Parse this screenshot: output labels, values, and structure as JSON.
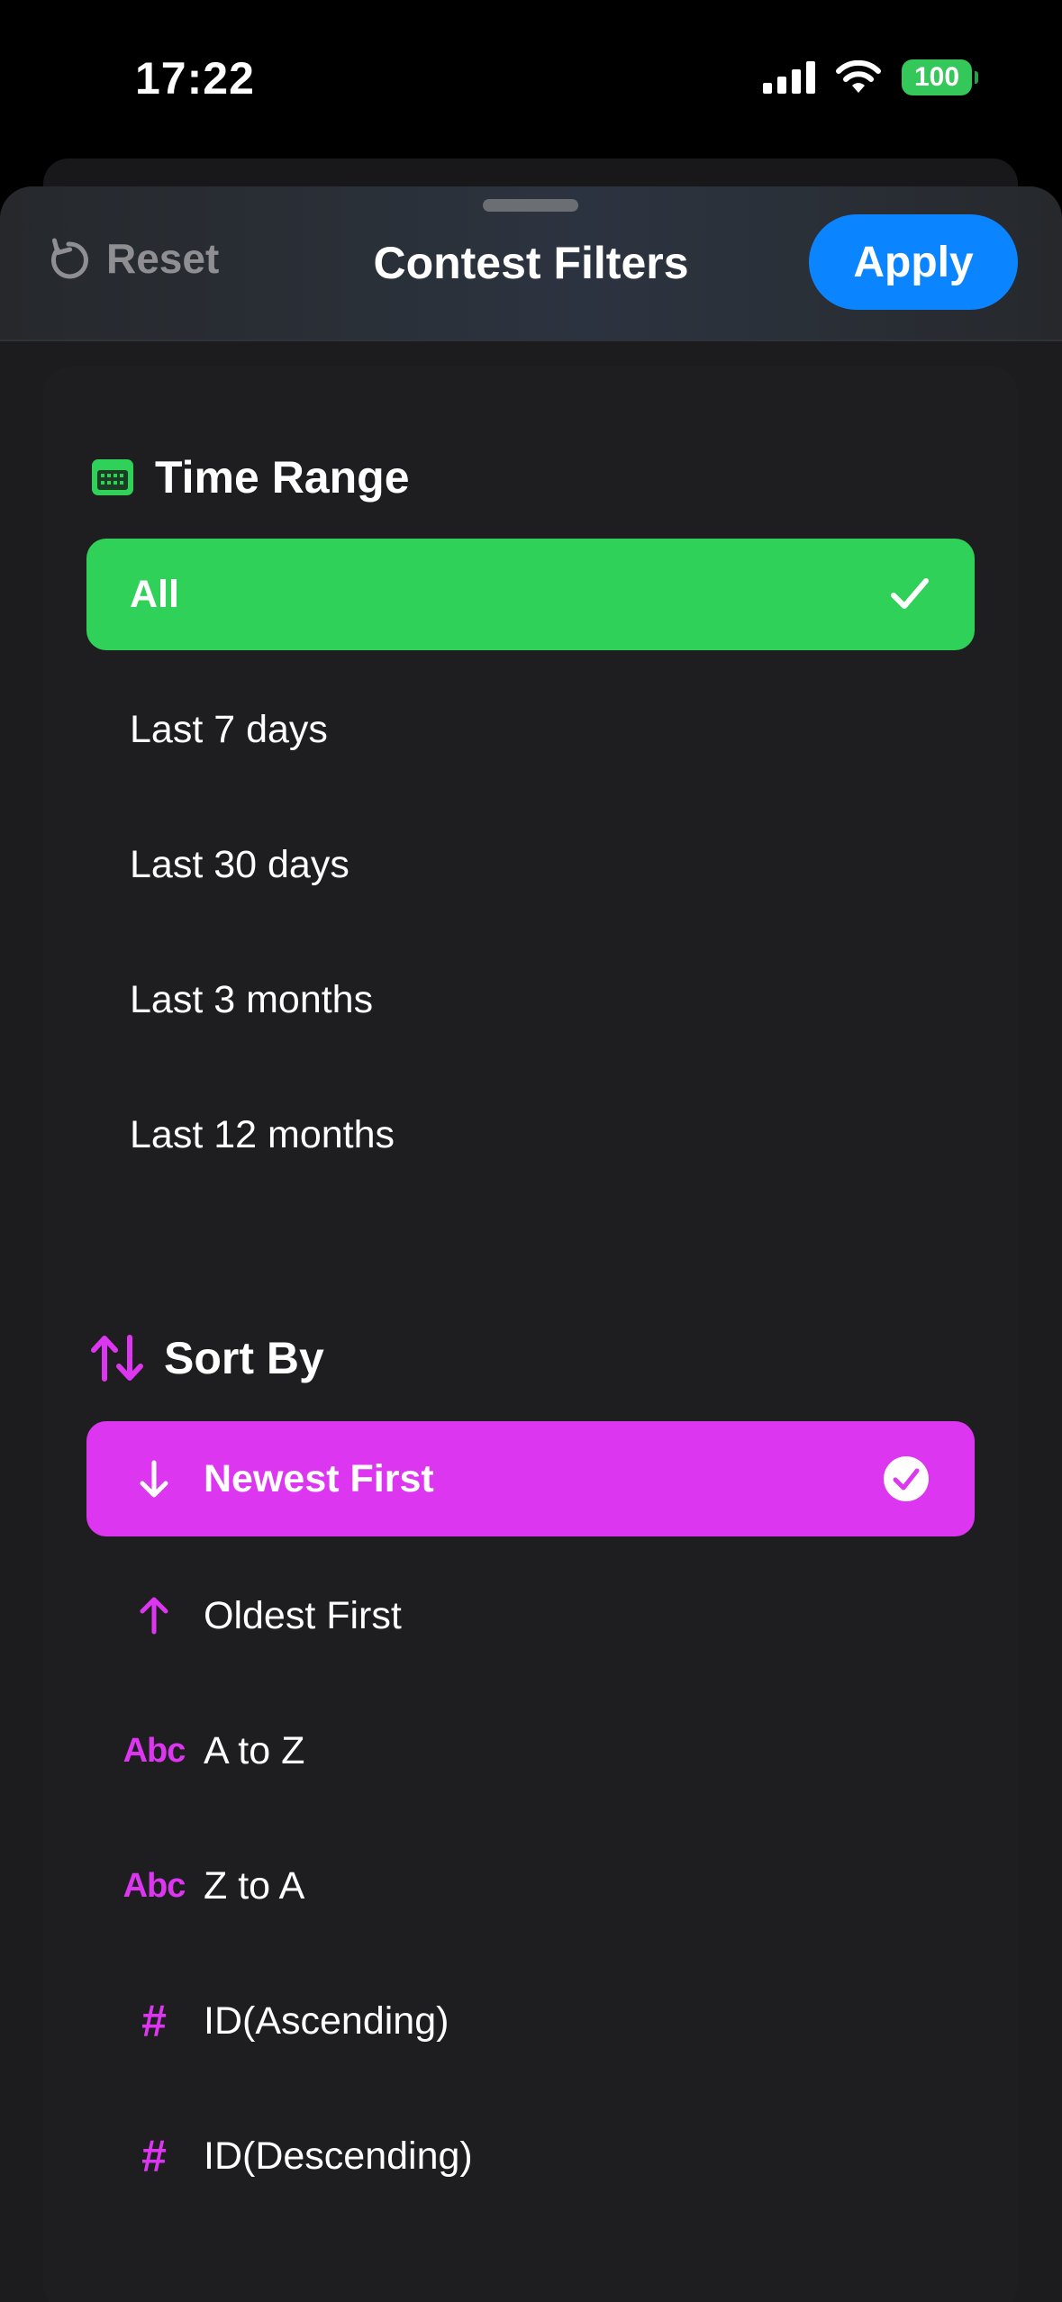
{
  "status_bar": {
    "time": "17:22",
    "battery": "100"
  },
  "nav": {
    "reset_label": "Reset",
    "title": "Contest Filters",
    "apply_label": "Apply"
  },
  "time_range": {
    "title": "Time Range",
    "options": [
      "All",
      "Last 7 days",
      "Last 30 days",
      "Last 3 months",
      "Last 12 months"
    ],
    "selected": "All"
  },
  "sort_by": {
    "title": "Sort By",
    "options": [
      {
        "label": "Newest First",
        "icon": "arrow-down-icon"
      },
      {
        "label": "Oldest First",
        "icon": "arrow-up-icon"
      },
      {
        "label": "A to Z",
        "icon": "abc-icon",
        "icon_text": "Abc"
      },
      {
        "label": "Z to A",
        "icon": "abc-icon",
        "icon_text": "Abc"
      },
      {
        "label": "ID(Ascending)",
        "icon": "hash-icon",
        "icon_text": "#"
      },
      {
        "label": "ID(Descending)",
        "icon": "hash-icon",
        "icon_text": "#"
      }
    ],
    "selected": "Newest First"
  },
  "colors": {
    "time_range_accent": "#30d158",
    "sort_accent": "#dc36f0",
    "apply_button": "#0a84ff",
    "sheet_background": "#1c1c1e"
  }
}
